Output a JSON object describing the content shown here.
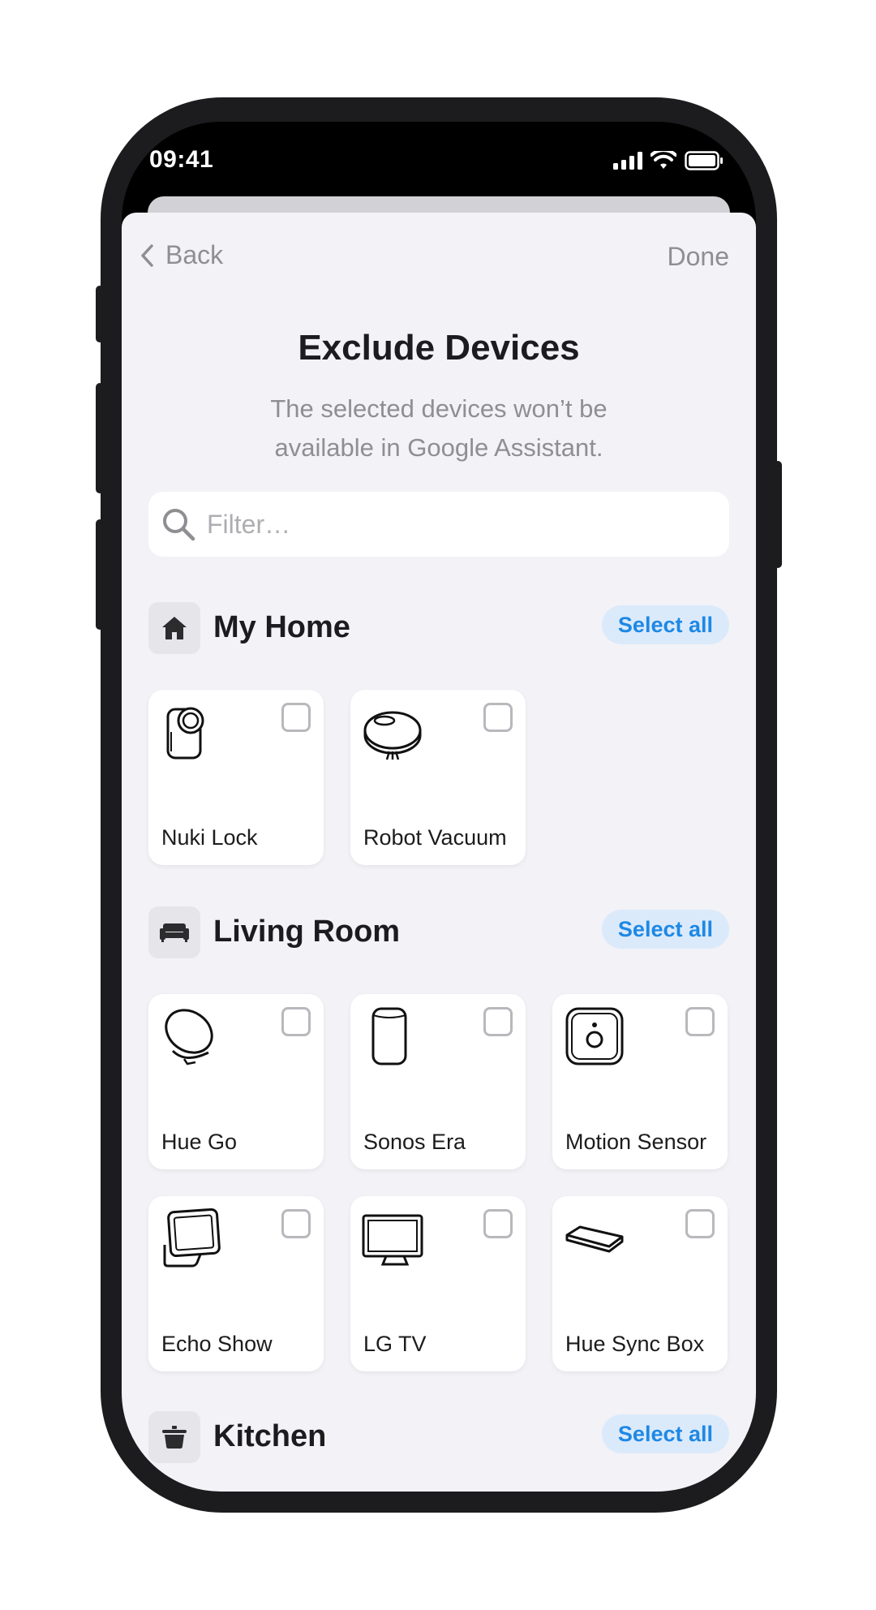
{
  "status_bar": {
    "time": "09:41"
  },
  "nav": {
    "back_label": "Back",
    "done_label": "Done"
  },
  "header": {
    "title": "Exclude Devices",
    "subtitle": "The selected devices won’t be available in Google Assistant."
  },
  "search": {
    "placeholder": "Filter…",
    "value": ""
  },
  "select_all_label": "Select all",
  "sections": [
    {
      "name": "My Home",
      "icon": "home-icon",
      "devices": [
        {
          "label": "Nuki Lock",
          "icon": "smart-lock-icon",
          "checked": false
        },
        {
          "label": "Robot Vacuum",
          "icon": "robot-vacuum-icon",
          "checked": false
        }
      ]
    },
    {
      "name": "Living Room",
      "icon": "sofa-icon",
      "devices": [
        {
          "label": "Hue Go",
          "icon": "hue-go-lamp-icon",
          "checked": false
        },
        {
          "label": "Sonos Era",
          "icon": "speaker-icon",
          "checked": false
        },
        {
          "label": "Motion Sensor",
          "icon": "motion-sensor-icon",
          "checked": false
        },
        {
          "label": "Echo Show",
          "icon": "smart-display-icon",
          "checked": false
        },
        {
          "label": "LG TV",
          "icon": "tv-icon",
          "checked": false
        },
        {
          "label": "Hue Sync Box",
          "icon": "sync-box-icon",
          "checked": false
        }
      ]
    },
    {
      "name": "Kitchen",
      "icon": "pot-icon",
      "devices": []
    }
  ]
}
